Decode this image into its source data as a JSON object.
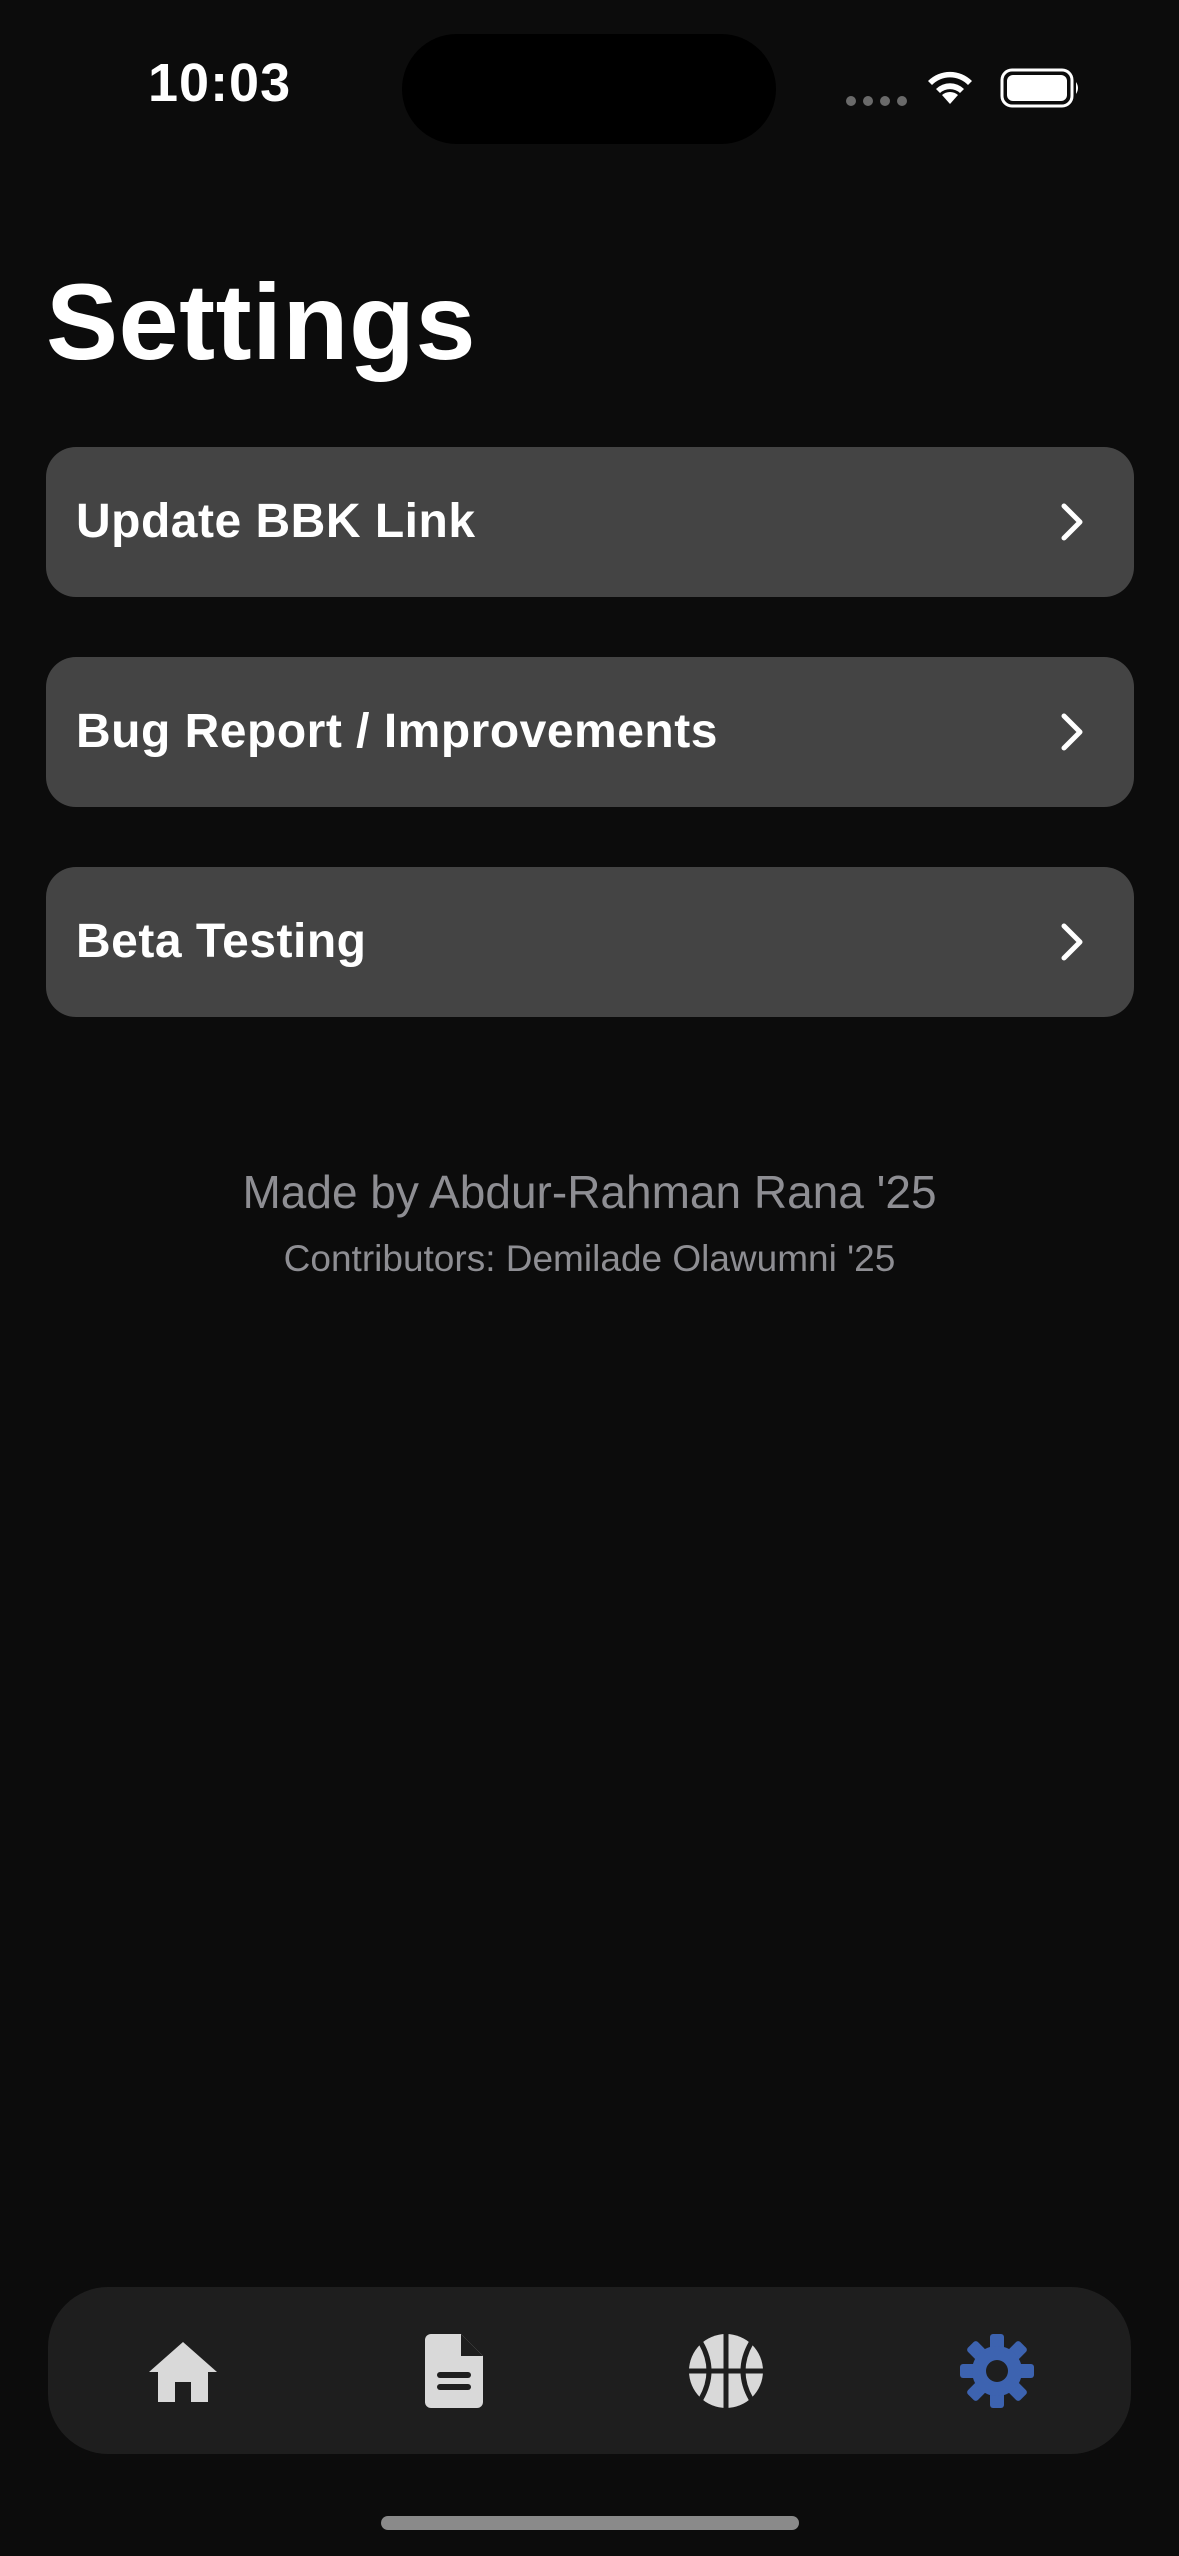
{
  "status_bar": {
    "time": "10:03",
    "icons": [
      "signal-dots-icon",
      "wifi-icon",
      "battery-icon"
    ]
  },
  "page": {
    "title": "Settings"
  },
  "settings": {
    "items": [
      {
        "label": "Update BBK Link",
        "icon": "chevron-right-icon"
      },
      {
        "label": "Bug Report / Improvements",
        "icon": "chevron-right-icon"
      },
      {
        "label": "Beta Testing",
        "icon": "chevron-right-icon"
      }
    ]
  },
  "credits": {
    "made_by": "Made by Abdur-Rahman Rana '25",
    "contributors": "Contributors: Demilade Olawumni '25"
  },
  "tab_bar": {
    "tabs": [
      {
        "icon": "home-icon",
        "active": false
      },
      {
        "icon": "document-icon",
        "active": false
      },
      {
        "icon": "basketball-icon",
        "active": false
      },
      {
        "icon": "gear-icon",
        "active": true
      }
    ],
    "active_color": "#3d63b0",
    "inactive_color": "#d9d9d9"
  },
  "colors": {
    "background": "#0c0c0c",
    "row_background": "#444444",
    "secondary_text": "#8e8e93"
  }
}
